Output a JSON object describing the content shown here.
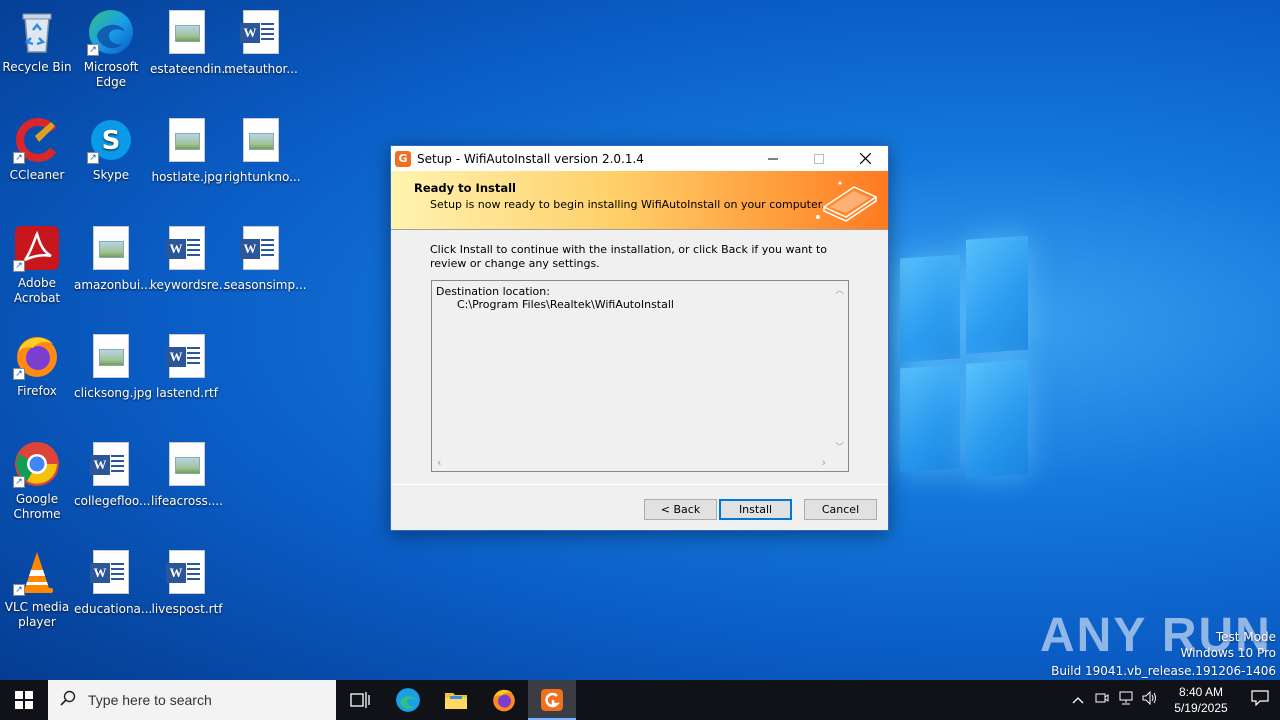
{
  "desktop": {
    "icons": [
      {
        "label": "Recycle Bin"
      },
      {
        "label": "Microsoft Edge"
      },
      {
        "label": "estateendin..."
      },
      {
        "label": "metauthor..."
      },
      {
        "label": "CCleaner"
      },
      {
        "label": "Skype"
      },
      {
        "label": "hostlate.jpg"
      },
      {
        "label": "rightunkno..."
      },
      {
        "label": "Adobe Acrobat"
      },
      {
        "label": "amazonbui..."
      },
      {
        "label": "keywordsre..."
      },
      {
        "label": "seasonsimp..."
      },
      {
        "label": "Firefox"
      },
      {
        "label": "clicksong.jpg"
      },
      {
        "label": "lastend.rtf"
      },
      {
        "label": "Google Chrome"
      },
      {
        "label": "collegefloo..."
      },
      {
        "label": "lifeacross...."
      },
      {
        "label": "VLC media player"
      },
      {
        "label": "educationa..."
      },
      {
        "label": "livespost.rtf"
      }
    ]
  },
  "dialog": {
    "title": "Setup - WifiAutoInstall version 2.0.1.4",
    "header_title": "Ready to Install",
    "header_subtitle": "Setup is now ready to begin installing WifiAutoInstall on your computer.",
    "instructions": "Click Install to continue with the installation, or click Back if you want to review or change any settings.",
    "memo": "Destination location:\n      C:\\Program Files\\Realtek\\WifiAutoInstall",
    "buttons": {
      "back": "< Back",
      "install": "Install",
      "cancel": "Cancel"
    }
  },
  "watermark": {
    "brand": "ANY RUN",
    "line1": "Test Mode",
    "line2": "Windows 10 Pro",
    "line3": "Build 19041.vb_release.191206-1406"
  },
  "taskbar": {
    "search_placeholder": "Type here to search",
    "time": "8:40 AM",
    "date": "5/19/2025"
  },
  "colors": {
    "accent": "#0078d7",
    "header_orange": "#ff7a20",
    "taskbar": "#101218"
  }
}
